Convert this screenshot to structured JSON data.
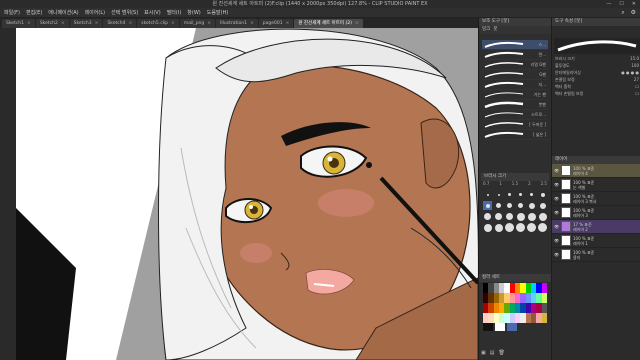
{
  "window": {
    "title": "원 진선세계 세트 아트미 (2)F.clip (1440 x 2000px 350dpi) 127.8%  - CLIP STUDIO PAINT EX",
    "controls": [
      "—",
      "☐",
      "✕"
    ]
  },
  "menu": {
    "items": [
      "파일(F)",
      "편집(E)",
      "애니메이션(A)",
      "레이어(L)",
      "선택 범위(S)",
      "표시(V)",
      "필터(I)",
      "창(W)",
      "도움말(H)"
    ]
  },
  "tabs": [
    {
      "label": "Sketch1",
      "active": false
    },
    {
      "label": "Sketch2",
      "active": false
    },
    {
      "label": "Sketch3",
      "active": false
    },
    {
      "label": "Sketch4",
      "active": false
    },
    {
      "label": "sketch5.clip",
      "active": false
    },
    {
      "label": "mail_png",
      "active": false
    },
    {
      "label": "Illustration1",
      "active": false
    },
    {
      "label": "page001",
      "active": false
    },
    {
      "label": "Illust1",
      "active": false
    },
    {
      "label": "원 진선세계 세트 아트미 (2)",
      "active": true
    }
  ],
  "brush_panel": {
    "header": "보조 도구 [붓]",
    "tabs": [
      "잉크",
      "붓"
    ],
    "items": [
      "스...",
      "면...",
      "리얼 G펜",
      "G펜",
      "지...",
      "가는 펜",
      "붓펜",
      "스트로...",
      "[ 두꺼운 ]",
      "[ 넓은 ]"
    ]
  },
  "brush_sizes": {
    "header": "브러시 크기",
    "labels": [
      "0.7",
      "1",
      "1.5",
      "2",
      "2.5"
    ]
  },
  "color_panel": {
    "header": "컬러 세트"
  },
  "tool_property": {
    "header": "도구 속성 [붓]",
    "rows": [
      {
        "label": "브러시 크기",
        "value": "15.0"
      },
      {
        "label": "불투명도",
        "value": "100"
      },
      {
        "label": "안티에일리어싱",
        "value": ""
      },
      {
        "label": "손떨림 보정",
        "value": "27"
      },
      {
        "label": "벡터 흡착",
        "value": ""
      },
      {
        "label": "벡터 손떨림 보정",
        "value": ""
      }
    ]
  },
  "layers": {
    "header": "레이어",
    "items": [
      {
        "blend": "100 % 표준",
        "name": "레이어 4",
        "hl": true
      },
      {
        "blend": "100 % 표준",
        "name": "눈 색칠",
        "hl": false
      },
      {
        "blend": "100 % 표준",
        "name": "레이어 3 복사",
        "hl": false
      },
      {
        "blend": "100 % 표준",
        "name": "레이어 3",
        "hl": false
      },
      {
        "blend": "17 % 표준",
        "name": "레이어 2",
        "hl": false
      },
      {
        "blend": "100 % 표준",
        "name": "레이어 1",
        "hl": false
      },
      {
        "blend": "100 % 표준",
        "name": "용지",
        "hl": false
      }
    ]
  },
  "colors": {
    "skin": "#b47652",
    "skin_shadow": "#8f5a3b",
    "hair": "#f2f2f2",
    "hair_shadow": "#c9c9c9",
    "lips": "#f3a9a0",
    "eye": "#d6b53a",
    "blush": "#d98880",
    "bg_gray": "#9c9c9c",
    "accent": "#4a6ab0"
  }
}
